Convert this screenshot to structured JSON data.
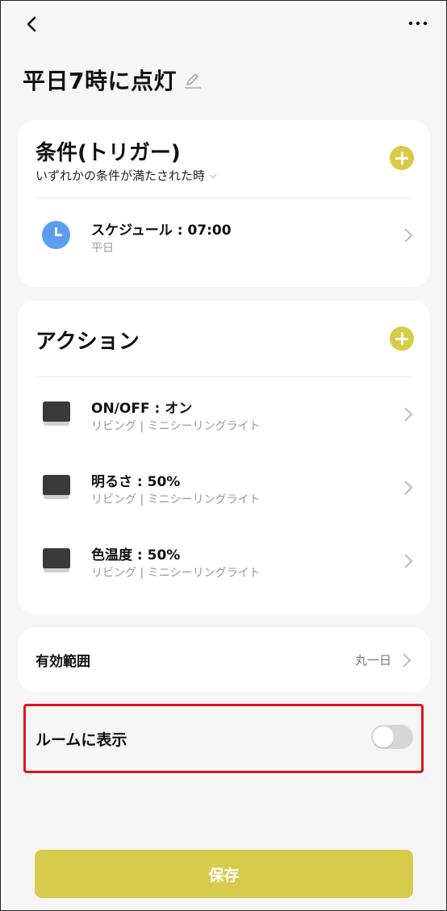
{
  "header": {
    "back_icon": "chevron-left-icon",
    "more_icon": "more-horizontal-icon",
    "title": "平日7時に点灯",
    "edit_icon": "pencil-icon"
  },
  "conditions": {
    "title": "条件(トリガー)",
    "mode": "いずれかの条件が満たされた時",
    "items": [
      {
        "icon": "clock-icon",
        "label": "スケジュール : 07:00",
        "sub": "平日"
      }
    ]
  },
  "actions": {
    "title": "アクション",
    "items": [
      {
        "icon": "ceiling-light-icon",
        "label": "ON/OFF : オン",
        "sub": "リビング | ミニシーリングライト"
      },
      {
        "icon": "ceiling-light-icon",
        "label": "明るさ : 50%",
        "sub": "リビング | ミニシーリングライト"
      },
      {
        "icon": "ceiling-light-icon",
        "label": "色温度 : 50%",
        "sub": "リビング | ミニシーリングライト"
      }
    ]
  },
  "effective_range": {
    "label": "有効範囲",
    "value": "丸一日"
  },
  "show_in_room": {
    "label": "ルームに表示",
    "enabled": false
  },
  "save_button": {
    "label": "保存"
  },
  "colors": {
    "accent": "#d8cb45",
    "highlight": "#e8101e",
    "clock": "#5b9ef0"
  }
}
